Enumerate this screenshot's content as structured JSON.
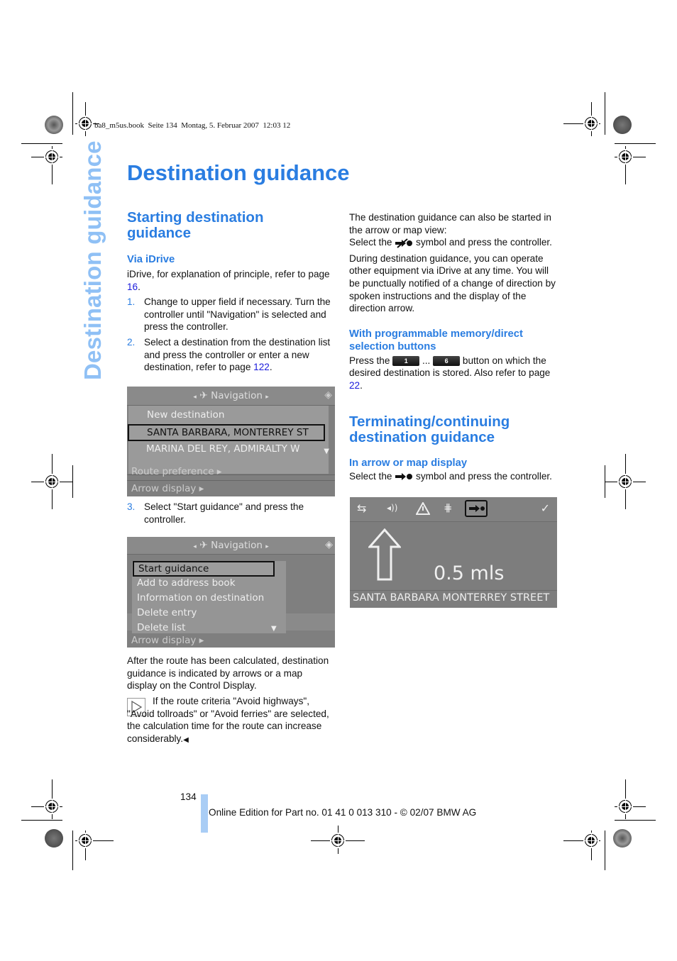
{
  "print_header": "ba8_m5us.book  Seite 134  Montag, 5. Februar 2007  12:03 12",
  "side_title": "Destination guidance",
  "page_title": "Destination guidance",
  "left": {
    "section_title": "Starting destination guidance",
    "subsection_title": "Via iDrive",
    "intro_text": "iDrive, for explanation of principle, refer to page ",
    "intro_link": "16",
    "steps": [
      {
        "num": "1.",
        "text": "Change to upper field if necessary. Turn the controller until \"Navigation\" is selected and press the controller."
      },
      {
        "num": "2.",
        "text": "Select a destination from the destination list and press the controller or enter a new destination, refer to page ",
        "link": "122"
      },
      {
        "num": "3.",
        "text": "Select \"Start guidance\" and press the controller."
      }
    ],
    "screen1": {
      "header": "Navigation",
      "items": [
        "New destination",
        "SANTA BARBARA, MONTERREY ST",
        "MARINA DEL REY, ADMIRALTY W"
      ],
      "selected_index": 1,
      "bottom_items": [
        "Route preference ▸",
        "Arrow display ▸"
      ]
    },
    "screen2": {
      "header": "Navigation",
      "items": [
        "Start guidance",
        "Add to address book",
        "Information on destination",
        "Delete entry",
        "Delete list"
      ],
      "selected_index": 0,
      "bottom_item": "Arrow display ▸"
    },
    "after_text": "After the route has been calculated, destination guidance is indicated by arrows or a map display on the Control Display.",
    "note_text": "If the route criteria \"Avoid highways\", \"Avoid tollroads\" or \"Avoid ferries\" are selected, the calculation time for the route can increase considerably."
  },
  "right": {
    "p1": "The destination guidance can also be started in the arrow or map view:",
    "p1b_pre": "Select the",
    "p1b_post": "symbol and press the controller.",
    "p2": "During destination guidance, you can operate other equipment via iDrive at any time. You will be punctually notified of a change of direction by spoken instructions and the display of the direction arrow.",
    "subsection_memory": "With programmable memory/direct selection buttons",
    "memory_pre": "Press the",
    "memory_key1": "1",
    "memory_mid": "...",
    "memory_key2": "6",
    "memory_post": "button on which the desired destination is stored. Also refer to page ",
    "memory_link": "22",
    "section_terminate": "Terminating/continuing destination guidance",
    "subsection_arrow": "In arrow or map display",
    "arrow_pre": "Select the",
    "arrow_post": "symbol and press the controller.",
    "screen3": {
      "icons": [
        "back-icon",
        "volume-icon",
        "warning-icon",
        "highway-icon",
        "guidance-icon",
        "check-icon"
      ],
      "distance": "0.5 mls",
      "street": "SANTA BARBARA MONTERREY STREET"
    }
  },
  "footer": {
    "page_number": "134",
    "edition": "Online Edition for Part no. 01 41 0 013 310 - © 02/07 BMW AG"
  }
}
